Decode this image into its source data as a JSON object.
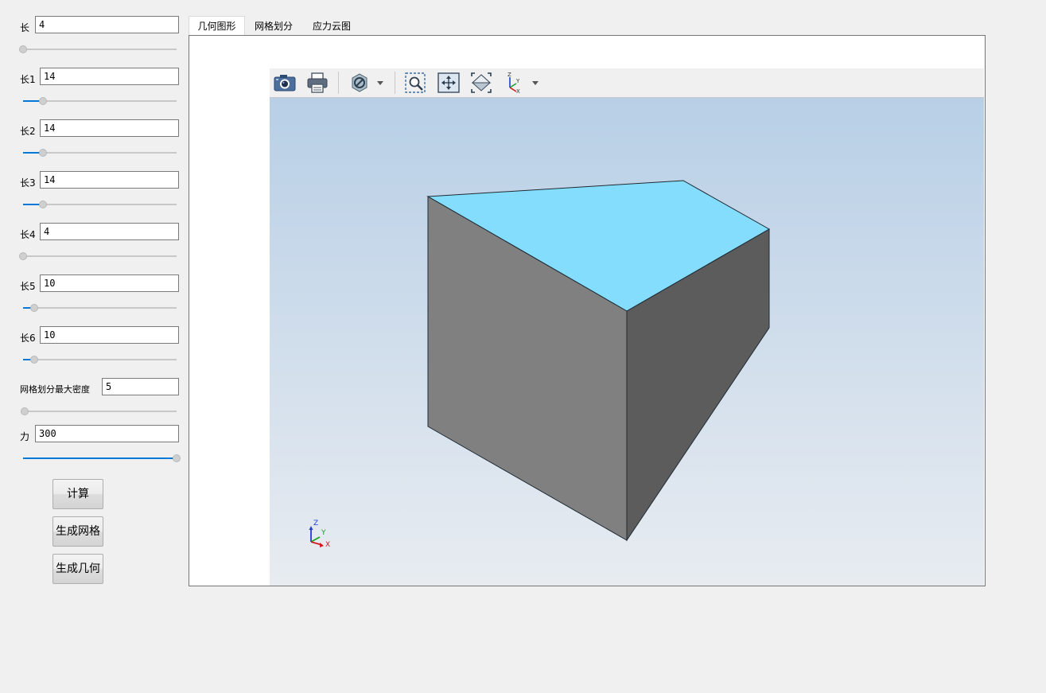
{
  "params": [
    {
      "label": "长",
      "value": "4",
      "fraction": 0.0
    },
    {
      "label": "长1",
      "value": "14",
      "fraction": 0.13
    },
    {
      "label": "长2",
      "value": "14",
      "fraction": 0.13
    },
    {
      "label": "长3",
      "value": "14",
      "fraction": 0.13
    },
    {
      "label": "长4",
      "value": "4",
      "fraction": 0.0
    },
    {
      "label": "长5",
      "value": "10",
      "fraction": 0.07
    },
    {
      "label": "长6",
      "value": "10",
      "fraction": 0.07
    },
    {
      "label": "网格划分最大密度",
      "value": "5",
      "fraction": 0.01
    },
    {
      "label": "力",
      "value": "300",
      "fraction": 1.0
    }
  ],
  "buttons": {
    "calc": "计算",
    "mesh": "生成网格",
    "geometry": "生成几何"
  },
  "tabs": [
    {
      "label": "几何图形",
      "active": true
    },
    {
      "label": "网格划分",
      "active": false
    },
    {
      "label": "应力云图",
      "active": false
    }
  ],
  "toolbar_icons": [
    "camera-icon",
    "print-icon",
    "hide-icon",
    "dropdown-icon",
    "zoom-window-icon",
    "fit-all-icon",
    "iso-view-icon",
    "axes-view-icon",
    "dropdown-icon"
  ],
  "triad": {
    "z": "Z",
    "y": "Y",
    "x": "X"
  },
  "colors": {
    "accent": "#0078d7",
    "top_face": "#85ddfd",
    "left_face": "#808080",
    "right_face": "#5c5c5c"
  }
}
